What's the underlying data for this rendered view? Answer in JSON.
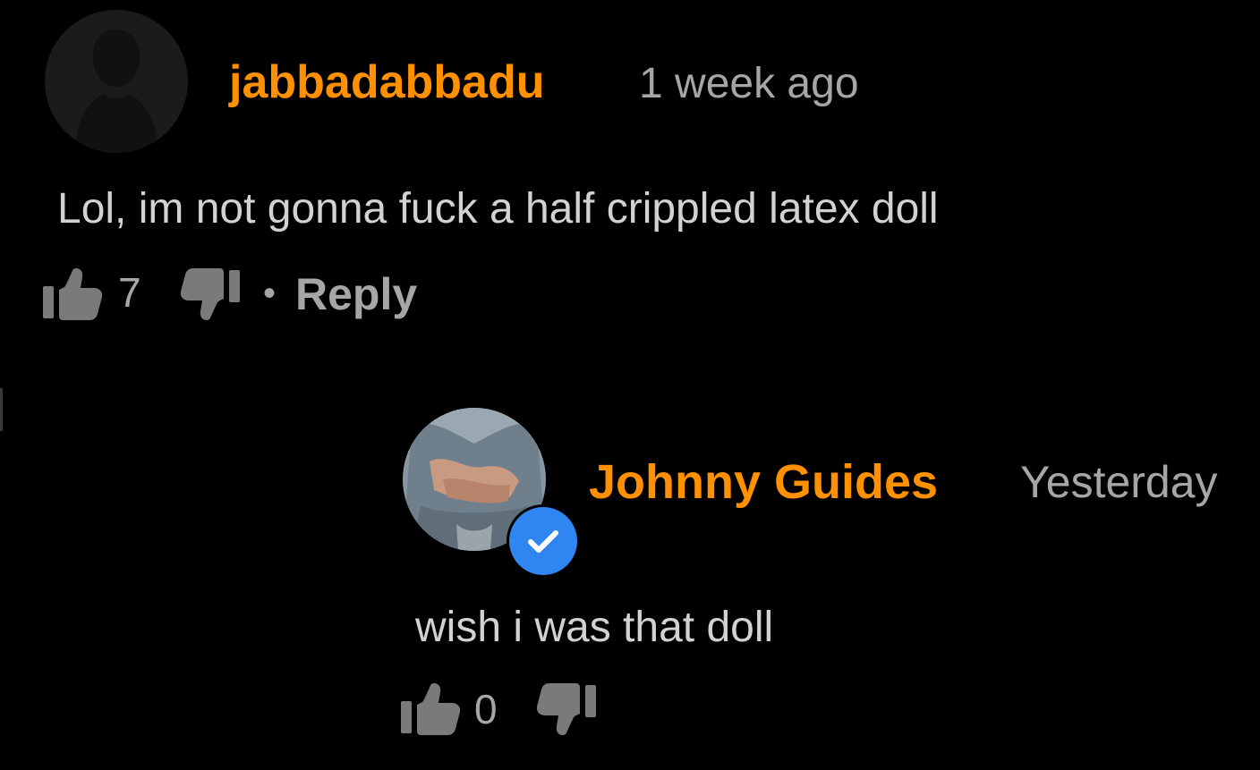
{
  "comments": [
    {
      "author": "jabbadabbadu",
      "time": "1 week ago",
      "text": "Lol, im not gonna fuck a half crippled latex doll",
      "likes": "7",
      "dot": "•",
      "reply_label": "Reply",
      "avatar_icon": "default-user-silhouette"
    },
    {
      "author": "Johnny Guides",
      "time": "Yesterday",
      "text": "wish i was that doll",
      "likes": "0",
      "verified": true,
      "avatar_icon": "user-photo"
    }
  ],
  "colors": {
    "background": "#000000",
    "username": "#ff9000",
    "muted": "#a6a6a6",
    "body": "#d2d2d2",
    "verified": "#2f86f0"
  }
}
